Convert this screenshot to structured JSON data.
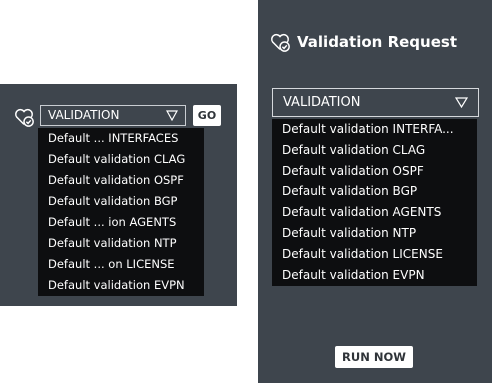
{
  "left_widget": {
    "icon": "heart-check-icon",
    "select": {
      "value": "VALIDATION",
      "caret_icon": "triangle-down-icon"
    },
    "go_label": "GO",
    "menu_items": [
      "Default ... INTERFACES",
      "Default validation CLAG",
      "Default validation OSPF",
      "Default validation BGP",
      "Default ... ion AGENTS",
      "Default validation NTP",
      "Default ... on LICENSE",
      "Default validation EVPN"
    ]
  },
  "right_panel": {
    "title": "Validation Request",
    "icon": "heart-check-icon",
    "select": {
      "value": "VALIDATION",
      "caret_icon": "triangle-down-icon"
    },
    "menu_items": [
      "Default validation INTERFA...",
      "Default validation CLAG",
      "Default validation OSPF",
      "Default validation BGP",
      "Default validation AGENTS",
      "Default validation NTP",
      "Default validation LICENSE",
      "Default validation EVPN"
    ],
    "run_label": "RUN NOW"
  },
  "colors": {
    "panel_bg": "#3e454d",
    "menu_bg": "#0d0e10",
    "text": "#ffffff",
    "button_bg": "#ffffff"
  }
}
